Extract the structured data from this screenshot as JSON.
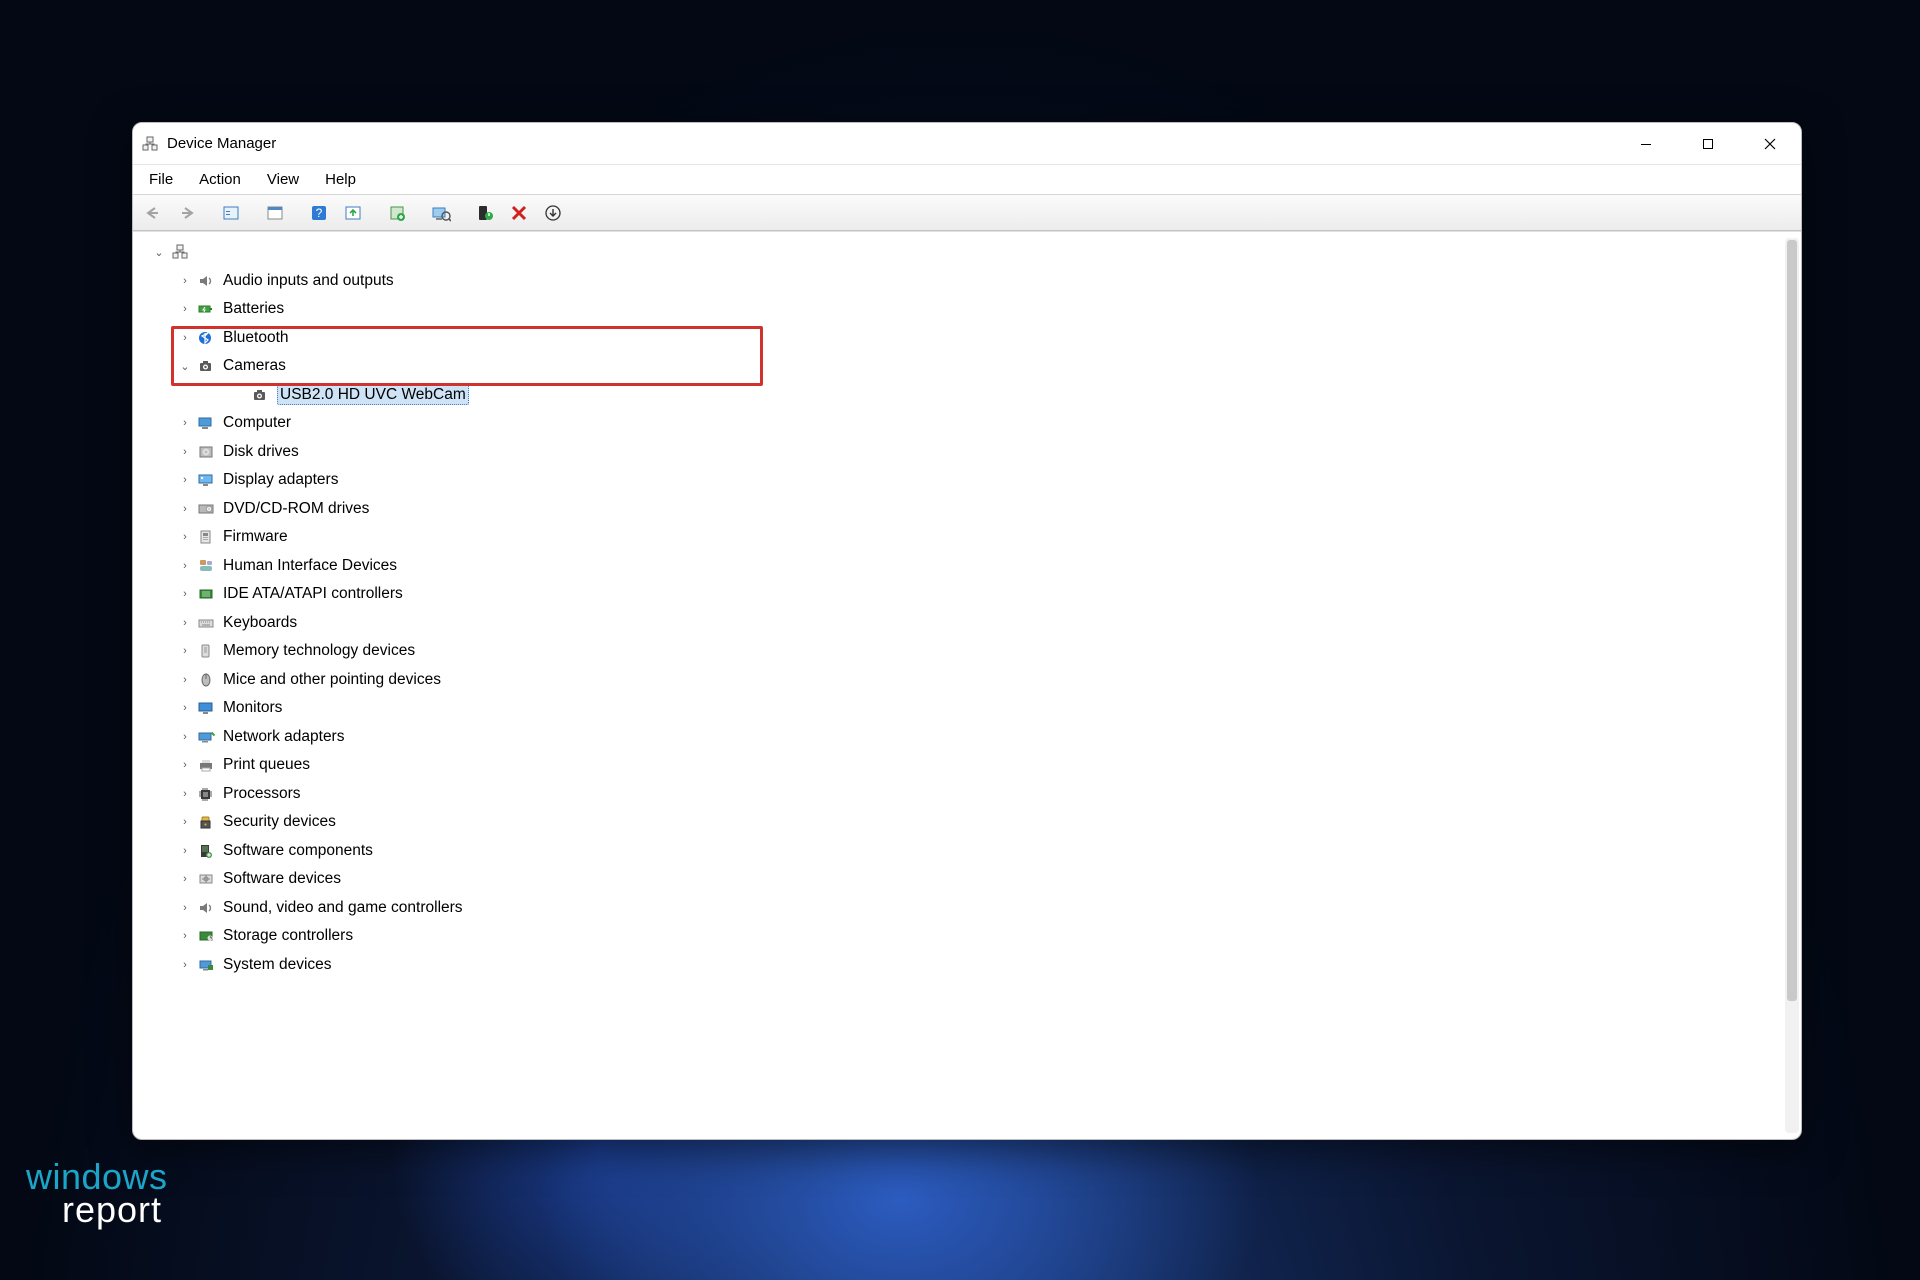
{
  "window": {
    "title": "Device Manager"
  },
  "menubar": [
    "File",
    "Action",
    "View",
    "Help"
  ],
  "toolbar_icons": [
    "back",
    "forward",
    "",
    "show-hidden",
    "",
    "help",
    "update-driver",
    "",
    "legacy-hardware",
    "",
    "uninstall",
    "scan-hardware",
    "",
    "remove-x",
    "properties-down"
  ],
  "tree": {
    "root": {
      "label": ""
    },
    "categories": [
      {
        "label": "Audio inputs and outputs",
        "icon": "speaker"
      },
      {
        "label": "Batteries",
        "icon": "battery"
      },
      {
        "label": "Bluetooth",
        "icon": "bluetooth"
      },
      {
        "label": "Cameras",
        "icon": "camera",
        "expanded": true,
        "children": [
          {
            "label": "USB2.0 HD UVC WebCam",
            "icon": "camera",
            "selected": true
          }
        ]
      },
      {
        "label": "Computer",
        "icon": "computer"
      },
      {
        "label": "Disk drives",
        "icon": "disk"
      },
      {
        "label": "Display adapters",
        "icon": "display"
      },
      {
        "label": "DVD/CD-ROM drives",
        "icon": "cdrom"
      },
      {
        "label": "Firmware",
        "icon": "firmware"
      },
      {
        "label": "Human Interface Devices",
        "icon": "hid"
      },
      {
        "label": "IDE ATA/ATAPI controllers",
        "icon": "ide"
      },
      {
        "label": "Keyboards",
        "icon": "keyboard"
      },
      {
        "label": "Memory technology devices",
        "icon": "memory"
      },
      {
        "label": "Mice and other pointing devices",
        "icon": "mouse"
      },
      {
        "label": "Monitors",
        "icon": "monitor"
      },
      {
        "label": "Network adapters",
        "icon": "network"
      },
      {
        "label": "Print queues",
        "icon": "printer"
      },
      {
        "label": "Processors",
        "icon": "processor"
      },
      {
        "label": "Security devices",
        "icon": "security"
      },
      {
        "label": "Software components",
        "icon": "software-comp"
      },
      {
        "label": "Software devices",
        "icon": "software-dev"
      },
      {
        "label": "Sound, video and game controllers",
        "icon": "speaker"
      },
      {
        "label": "Storage controllers",
        "icon": "storage"
      },
      {
        "label": "System devices",
        "icon": "system"
      }
    ]
  },
  "watermark": {
    "line1": "windows",
    "line2": "report"
  }
}
